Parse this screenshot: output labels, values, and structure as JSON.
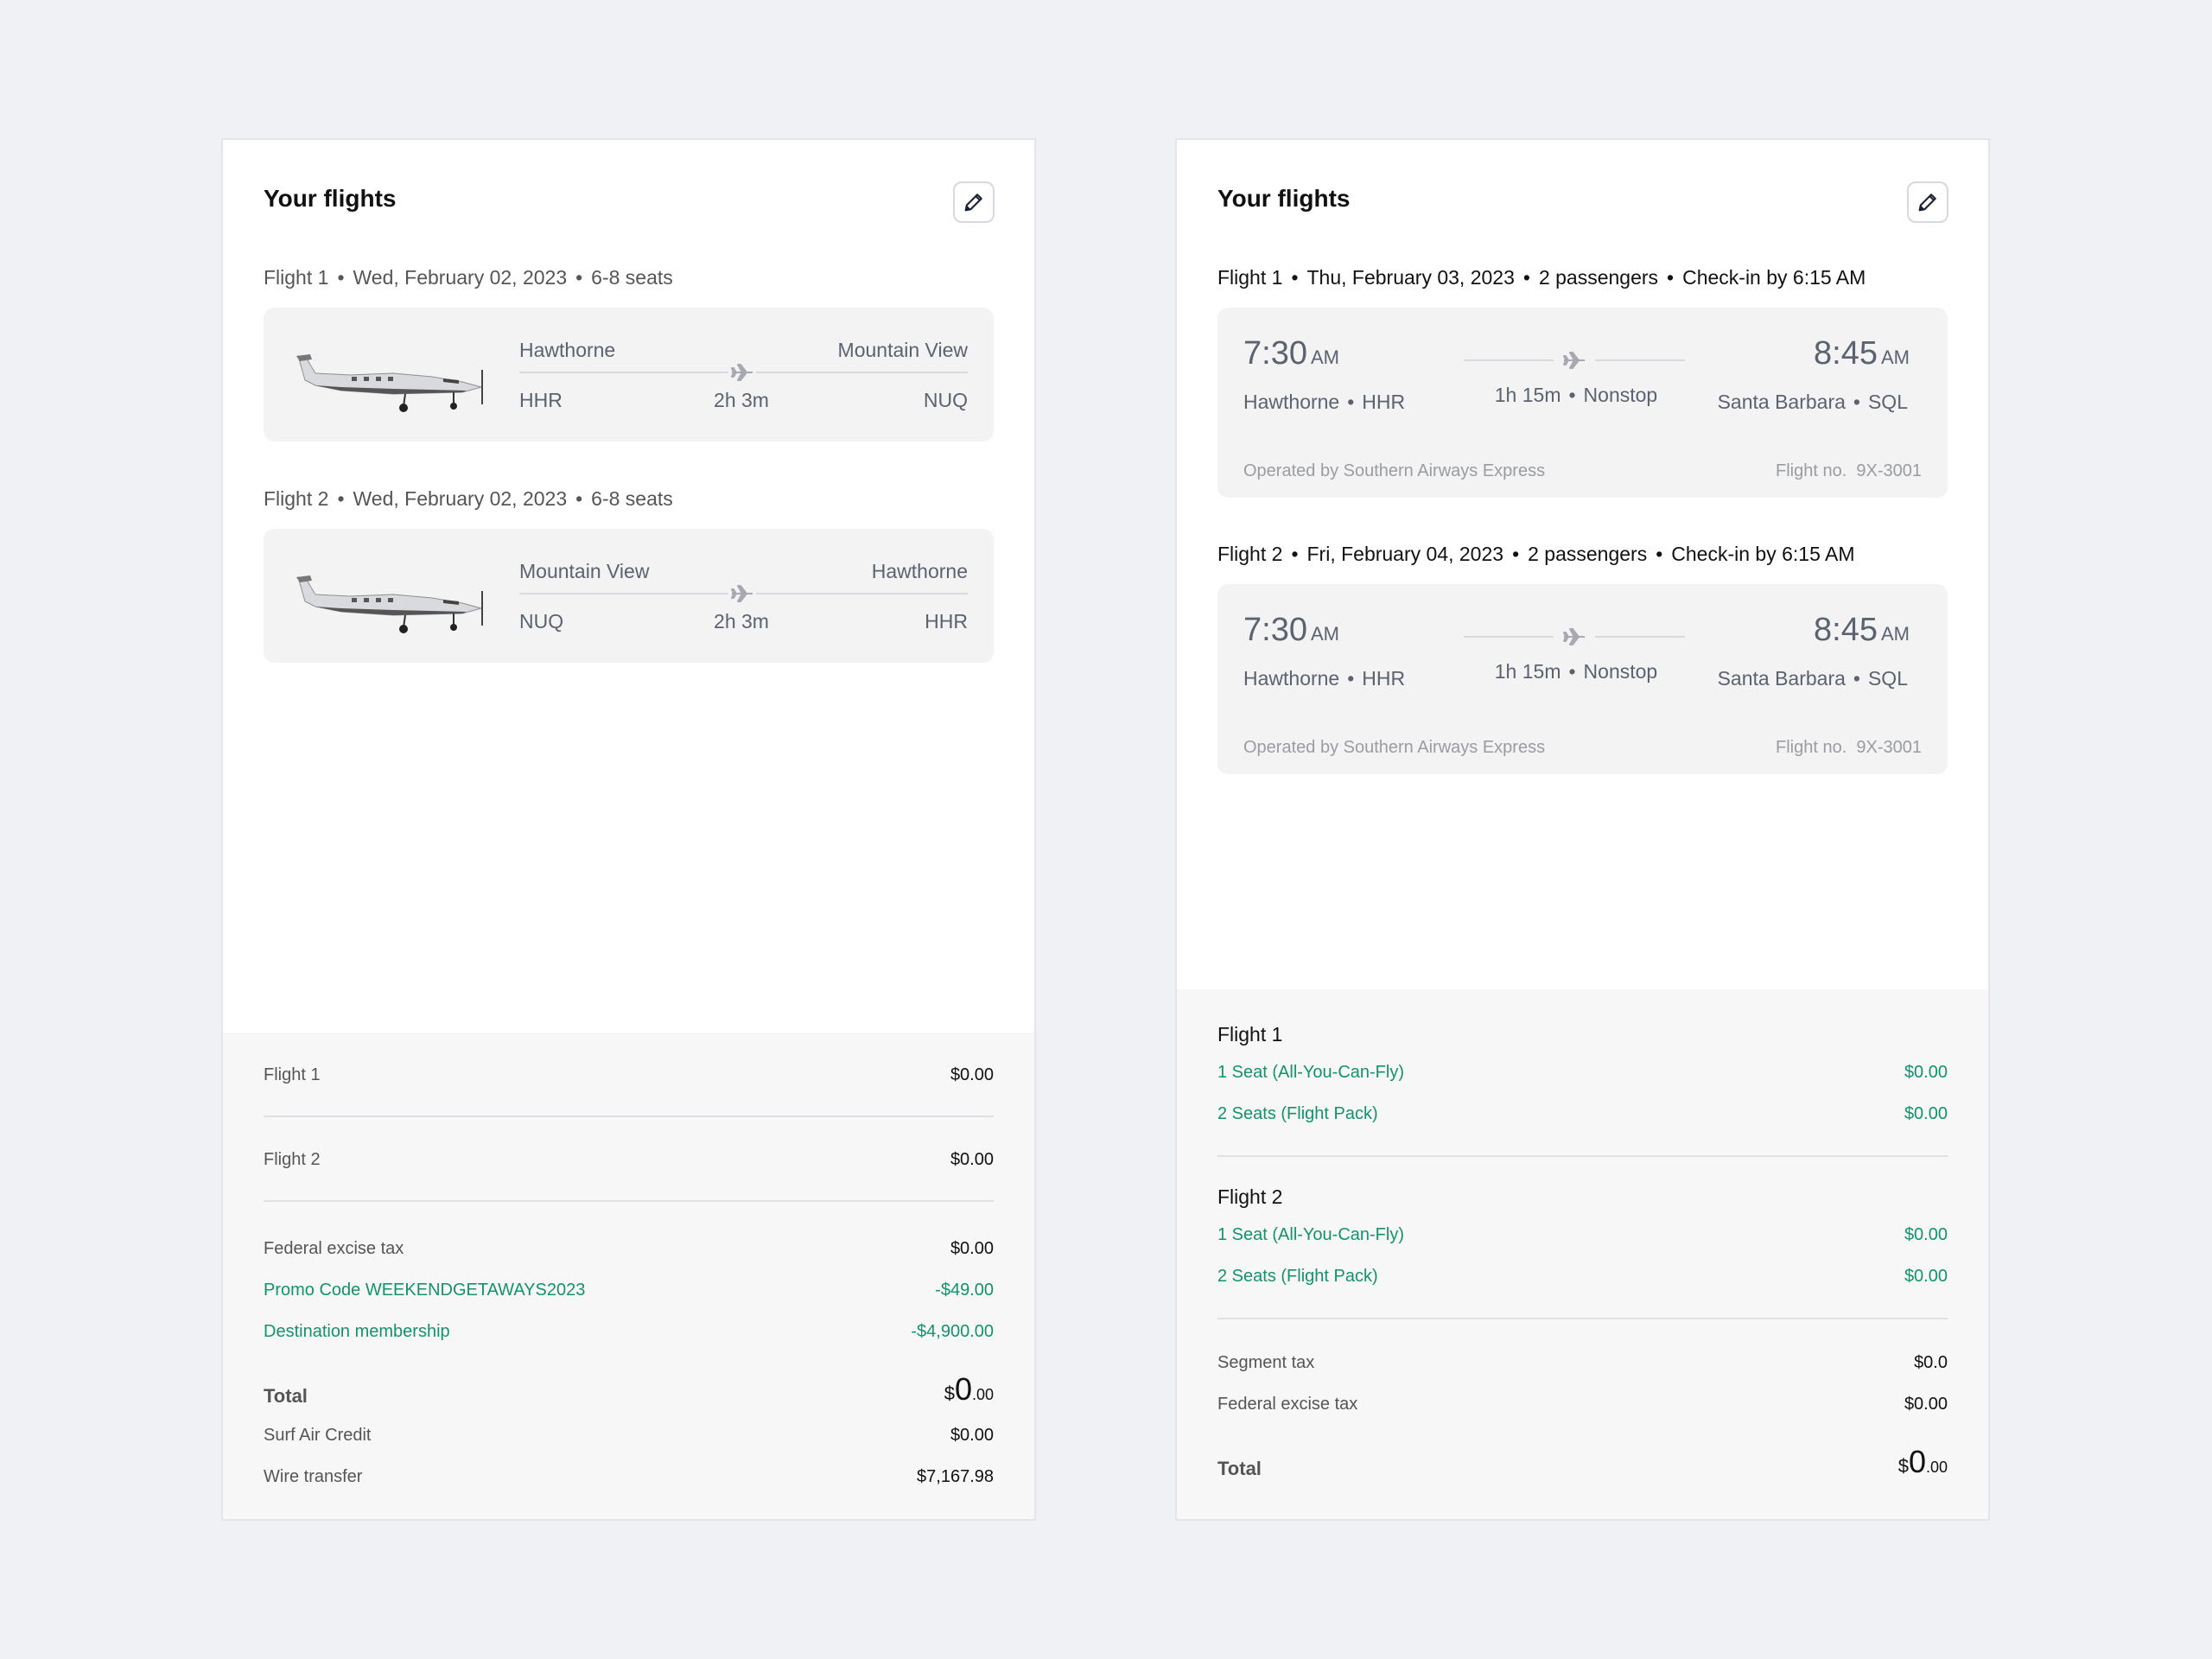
{
  "left": {
    "title": "Your flights",
    "flights": [
      {
        "label": "Flight 1",
        "date": "Wed, February 02, 2023",
        "seats": "6-8 seats",
        "from_city": "Hawthorne",
        "to_city": "Mountain View",
        "from_code": "HHR",
        "to_code": "NUQ",
        "duration": "2h 3m"
      },
      {
        "label": "Flight 2",
        "date": "Wed, February 02, 2023",
        "seats": "6-8 seats",
        "from_city": "Mountain View",
        "to_city": "Hawthorne",
        "from_code": "NUQ",
        "to_code": "HHR",
        "duration": "2h 3m"
      }
    ],
    "summary": {
      "flight1": {
        "label": "Flight 1",
        "amount": "$0.00"
      },
      "flight2": {
        "label": "Flight 2",
        "amount": "$0.00"
      },
      "tax": {
        "label": "Federal excise tax",
        "amount": "$0.00"
      },
      "promo": {
        "label": "Promo Code WEEKENDGETAWAYS2023",
        "amount": "-$49.00"
      },
      "membership": {
        "label": "Destination membership",
        "amount": "-$4,900.00"
      },
      "total": {
        "label": "Total",
        "currency": "$",
        "whole": "0",
        "cents": ".00"
      },
      "credit": {
        "label": "Surf Air Credit",
        "amount": "$0.00"
      },
      "wire": {
        "label": "Wire transfer",
        "amount": "$7,167.98"
      }
    }
  },
  "right": {
    "title": "Your flights",
    "flights": [
      {
        "label": "Flight 1",
        "date": "Thu, February 03, 2023",
        "passengers": "2 passengers",
        "checkin": "Check-in by 6:15 AM",
        "dep_time": "7:30",
        "dep_ampm": "AM",
        "arr_time": "8:45",
        "arr_ampm": "AM",
        "dep_city": "Hawthorne",
        "dep_code": "HHR",
        "arr_city": "Santa Barbara",
        "arr_code": "SQL",
        "duration": "1h 15m",
        "stops": "Nonstop",
        "operated": "Operated by Southern Airways Express",
        "flight_no": "Flight no.  9X-3001"
      },
      {
        "label": "Flight 2",
        "date": "Fri, February 04, 2023",
        "passengers": "2 passengers",
        "checkin": "Check-in by 6:15 AM",
        "dep_time": "7:30",
        "dep_ampm": "AM",
        "arr_time": "8:45",
        "arr_ampm": "AM",
        "dep_city": "Hawthorne",
        "dep_code": "HHR",
        "arr_city": "Santa Barbara",
        "arr_code": "SQL",
        "duration": "1h 15m",
        "stops": "Nonstop",
        "operated": "Operated by Southern Airways Express",
        "flight_no": "Flight no.  9X-3001"
      }
    ],
    "summary": {
      "f1": {
        "title": "Flight 1",
        "items": [
          {
            "label": "1 Seat (All-You-Can-Fly)",
            "amount": "$0.00"
          },
          {
            "label": "2 Seats (Flight Pack)",
            "amount": "$0.00"
          }
        ]
      },
      "f2": {
        "title": "Flight 2",
        "items": [
          {
            "label": "1 Seat (All-You-Can-Fly)",
            "amount": "$0.00"
          },
          {
            "label": "2 Seats (Flight Pack)",
            "amount": "$0.00"
          }
        ]
      },
      "segment_tax": {
        "label": "Segment tax",
        "amount": "$0.0"
      },
      "tax": {
        "label": "Federal excise tax",
        "amount": "$0.00"
      },
      "total": {
        "label": "Total",
        "currency": "$",
        "whole": "0",
        "cents": ".00"
      }
    }
  },
  "colors": {
    "background": "#f0f1f5",
    "card": "#ffffff",
    "flight_box": "#f3f3f4",
    "summary_bg": "#f7f7f8",
    "discount_green": "#13936a",
    "muted_text": "#5b6270"
  },
  "icons": {
    "edit": "pencil-icon",
    "route": "airplane-icon",
    "aircraft": "aircraft-image"
  }
}
